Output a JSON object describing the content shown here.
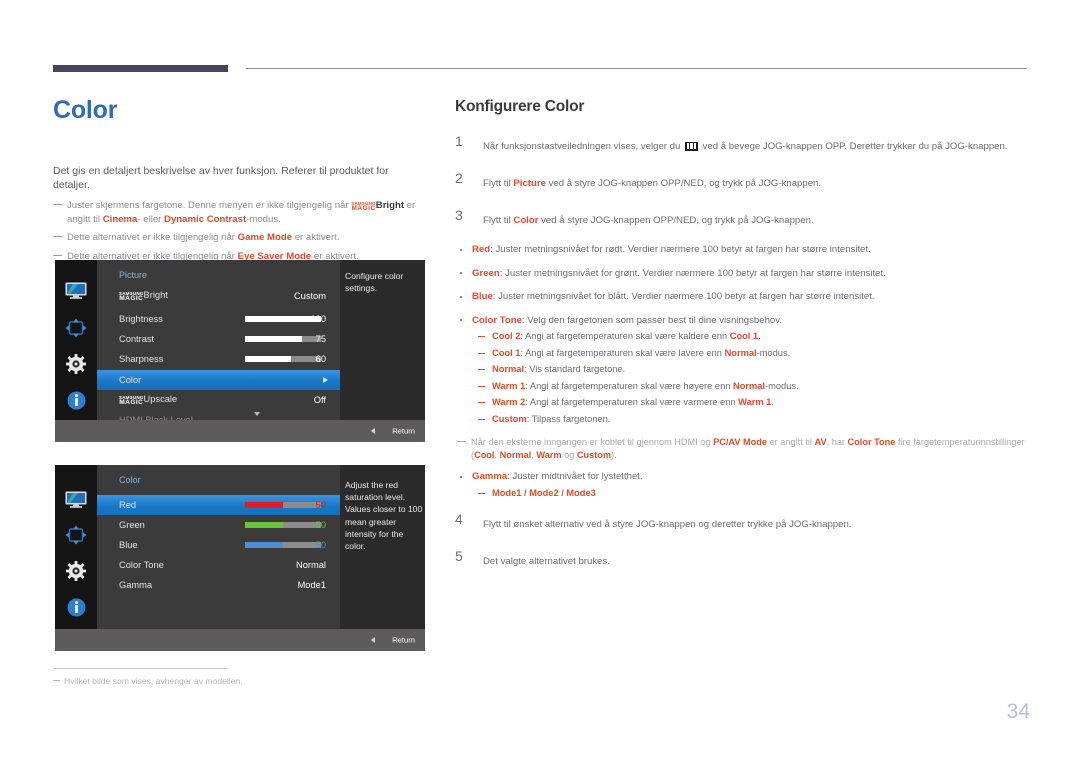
{
  "page_number": "34",
  "left": {
    "heading": "Color",
    "lead": "Det gis en detaljert beskrivelse av hver funksjon. Referer til produktet for detaljer.",
    "notes": [
      {
        "parts": [
          {
            "t": "Juster skjermens fargetone. Denne menyen er ikke tilgjengelig når ",
            "b": false
          },
          {
            "t": "MAGICBRIGHT_LOGO",
            "b": false
          },
          {
            "t": "Bright",
            "b": "dark"
          },
          {
            "t": " er angitt til ",
            "b": false
          },
          {
            "t": "Cinema",
            "b": true
          },
          {
            "t": "- eller ",
            "b": false
          },
          {
            "t": "Dynamic Contrast",
            "b": true
          },
          {
            "t": "-modus.",
            "b": false
          }
        ]
      },
      {
        "parts": [
          {
            "t": "Dette alternativet er ikke tilgjengelig når ",
            "b": false
          },
          {
            "t": "Game Mode",
            "b": true
          },
          {
            "t": " er aktivert.",
            "b": false
          }
        ]
      },
      {
        "parts": [
          {
            "t": "Dette alternativet er ikke tilgjengelig når ",
            "b": false
          },
          {
            "t": "Eye Saver Mode",
            "b": true
          },
          {
            "t": " er aktivert.",
            "b": false
          }
        ]
      }
    ],
    "footnote": "Hvilket bilde som vises, avhenger av modellen."
  },
  "osd1": {
    "title": "Picture",
    "side_text": "Configure color settings.",
    "return_label": "Return",
    "rail_icons": [
      "display-icon",
      "onscreen-display-icon",
      "system-gear-icon",
      "information-icon"
    ],
    "rows": [
      {
        "label": "MAGICBright",
        "magic": true,
        "value": "Custom",
        "slider": null,
        "state": "normal"
      },
      {
        "label": "Brightness",
        "magic": false,
        "value": "100",
        "slider": 100,
        "state": "normal"
      },
      {
        "label": "Contrast",
        "magic": false,
        "value": "75",
        "slider": 75,
        "state": "normal"
      },
      {
        "label": "Sharpness",
        "magic": false,
        "value": "60",
        "slider": 60,
        "state": "normal"
      },
      {
        "label": "Color",
        "magic": false,
        "value": "",
        "slider": null,
        "state": "selected"
      },
      {
        "label": "MAGICUpscale",
        "magic": true,
        "value": "Off",
        "slider": null,
        "state": "normal"
      },
      {
        "label": "HDMI Black Level",
        "magic": false,
        "value": "",
        "slider": null,
        "state": "dim"
      }
    ]
  },
  "osd2": {
    "title": "Color",
    "side_text": "Adjust the red saturation level. Values closer to 100 mean greater intensity for the color.",
    "return_label": "Return",
    "rail_icons": [
      "display-icon",
      "onscreen-display-icon",
      "system-gear-icon",
      "information-icon"
    ],
    "rows": [
      {
        "label": "Red",
        "value": "50",
        "slider": 50,
        "color": "#e01c20",
        "state": "selected"
      },
      {
        "label": "Green",
        "value": "50",
        "slider": 50,
        "color": "#63c63c",
        "state": "normal"
      },
      {
        "label": "Blue",
        "value": "50",
        "slider": 50,
        "color": "#4a90d9",
        "state": "normal"
      },
      {
        "label": "Color Tone",
        "value": "Normal",
        "slider": null,
        "color": null,
        "state": "normal"
      },
      {
        "label": "Gamma",
        "value": "Mode1",
        "slider": null,
        "color": null,
        "state": "normal"
      }
    ]
  },
  "right": {
    "heading": "Konfigurere Color",
    "steps": [
      {
        "num": "1",
        "parts": [
          {
            "t": "Når funksjonstastveiledningen vises, velger du ",
            "b": false
          },
          {
            "t": "MENU_GLYPH",
            "b": false
          },
          {
            "t": " ved å bevege JOG-knappen OPP. Deretter trykker du på JOG-knappen.",
            "b": false
          }
        ]
      },
      {
        "num": "2",
        "parts": [
          {
            "t": "Flytt til ",
            "b": false
          },
          {
            "t": "Picture",
            "b": true
          },
          {
            "t": " ved å styre JOG-knappen OPP/NED, og trykk på JOG-knappen.",
            "b": false
          }
        ]
      },
      {
        "num": "3",
        "parts": [
          {
            "t": "Flytt til ",
            "b": false
          },
          {
            "t": "Color",
            "b": true
          },
          {
            "t": " ved å styre JOG-knappen OPP/NED, og trykk på JOG-knappen.",
            "b": false
          }
        ]
      }
    ],
    "bullets": [
      {
        "parts": [
          {
            "t": "Red",
            "b": true
          },
          {
            "t": ": Juster metningsnivået for rødt. Verdier nærmere 100 betyr at fargen har større intensitet.",
            "b": false
          }
        ],
        "subs": []
      },
      {
        "parts": [
          {
            "t": "Green",
            "b": true
          },
          {
            "t": ": Juster metningsnivået for grønt. Verdier nærmere 100 betyr at fargen har større intensitet.",
            "b": false
          }
        ],
        "subs": []
      },
      {
        "parts": [
          {
            "t": "Blue",
            "b": true
          },
          {
            "t": ": Juster metningsnivået for blått. Verdier nærmere 100 betyr at fargen har større intensitet.",
            "b": false
          }
        ],
        "subs": []
      },
      {
        "parts": [
          {
            "t": "Color Tone",
            "b": true
          },
          {
            "t": ": Velg den fargetonen som passer best til dine visningsbehov.",
            "b": false
          }
        ],
        "subs": [
          {
            "parts": [
              {
                "t": "Cool 2",
                "b": true
              },
              {
                "t": ": Angi at fargetemperaturen skal være kaldere enn ",
                "b": false
              },
              {
                "t": "Cool 1",
                "b": true
              },
              {
                "t": ".",
                "b": false
              }
            ]
          },
          {
            "parts": [
              {
                "t": "Cool 1",
                "b": true
              },
              {
                "t": ": Angi at fargetemperaturen skal være lavere enn ",
                "b": false
              },
              {
                "t": "Normal",
                "b": true
              },
              {
                "t": "-modus.",
                "b": false
              }
            ]
          },
          {
            "parts": [
              {
                "t": "Normal",
                "b": true
              },
              {
                "t": ": Vis standard fargetone.",
                "b": false
              }
            ]
          },
          {
            "parts": [
              {
                "t": "Warm 1",
                "b": true
              },
              {
                "t": ": Angi at fargetemperaturen skal være høyere enn ",
                "b": false
              },
              {
                "t": "Normal",
                "b": true
              },
              {
                "t": "-modus.",
                "b": false
              }
            ]
          },
          {
            "parts": [
              {
                "t": "Warm 2",
                "b": true
              },
              {
                "t": ": Angi at fargetemperaturen skal være varmere enn ",
                "b": false
              },
              {
                "t": "Warm 1",
                "b": true
              },
              {
                "t": ".",
                "b": false
              }
            ]
          },
          {
            "parts": [
              {
                "t": "Custom",
                "b": true
              },
              {
                "t": ": Tilpass fargetonen.",
                "b": false
              }
            ]
          }
        ]
      }
    ],
    "inner_note": {
      "parts": [
        {
          "t": "Når den eksterne inngangen er koblet til gjennom HDMI og ",
          "b": false
        },
        {
          "t": "PC/AV Mode",
          "b": true
        },
        {
          "t": " er angitt til ",
          "b": false
        },
        {
          "t": "AV",
          "b": true
        },
        {
          "t": ", har ",
          "b": false
        },
        {
          "t": "Color Tone",
          "b": true
        },
        {
          "t": " fire fargetemperaturinnstillinger (",
          "b": false
        },
        {
          "t": "Cool",
          "b": true
        },
        {
          "t": ", ",
          "b": false
        },
        {
          "t": "Normal",
          "b": true
        },
        {
          "t": ", ",
          "b": false
        },
        {
          "t": "Warm",
          "b": true
        },
        {
          "t": " og ",
          "b": false
        },
        {
          "t": "Custom",
          "b": true
        },
        {
          "t": ").",
          "b": false
        }
      ]
    },
    "gamma_bullet": {
      "parts": [
        {
          "t": "Gamma",
          "b": true
        },
        {
          "t": ": Juster midtnivået for lystetthet.",
          "b": false
        }
      ],
      "subs": [
        {
          "parts": [
            {
              "t": "Mode1 / Mode2 / Mode3",
              "b": true
            }
          ]
        }
      ]
    },
    "steps_tail": [
      {
        "num": "4",
        "parts": [
          {
            "t": "Flytt til ønsket alternativ ved å styre JOG-knappen og deretter trykke på JOG-knappen.",
            "b": false
          }
        ]
      },
      {
        "num": "5",
        "parts": [
          {
            "t": "Det valgte alternativet brukes.",
            "b": false
          }
        ]
      }
    ]
  },
  "colors": {
    "heading_blue": "#2e6db4",
    "accent_orange": "#e24a2a",
    "osd_highlight_blue": "#1878c8",
    "osd_panel": "#3b3b3b",
    "osd_bg": "#2b2b2b"
  }
}
